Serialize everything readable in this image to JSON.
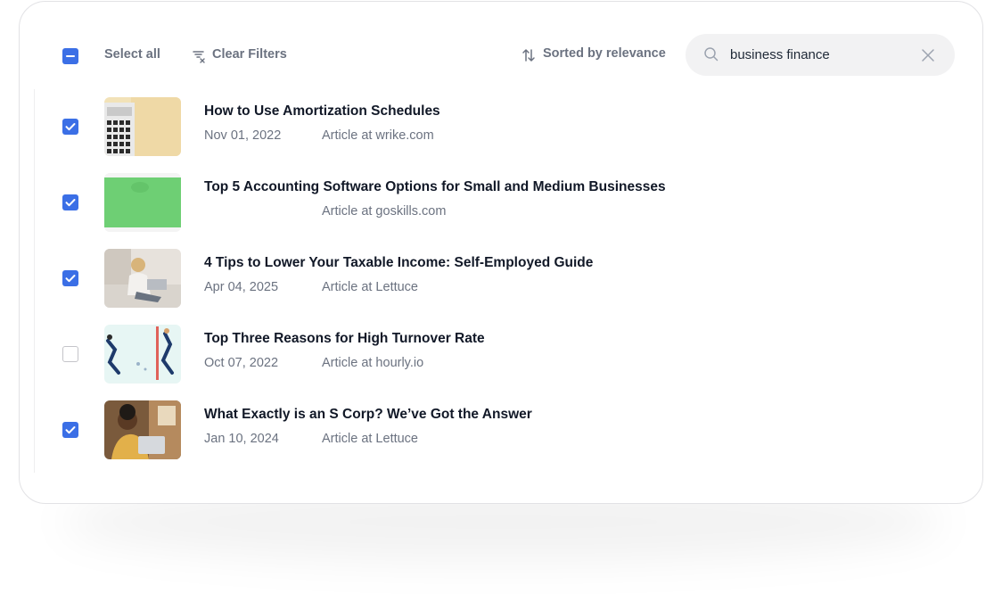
{
  "toolbar": {
    "select_all_label": "Select all",
    "select_all_state": "indeterminate",
    "clear_filters_label": "Clear Filters",
    "sort_label": "Sorted by relevance"
  },
  "search": {
    "value": "business finance",
    "placeholder": ""
  },
  "colors": {
    "accent": "#3b6fe6",
    "muted_text": "#6b7280",
    "search_bg": "#f2f2f3"
  },
  "results": [
    {
      "title": "How to Use Amortization Schedules",
      "date": "Nov 01, 2022",
      "source": "Article at wrike.com",
      "checked": true,
      "thumb": "calculator-thumbnail"
    },
    {
      "title": "Top 5 Accounting Software Options for Small and Medium Businesses",
      "date": "",
      "source": "Article at goskills.com",
      "checked": true,
      "thumb": "green-thumbnail"
    },
    {
      "title": "4 Tips to Lower Your Taxable Income: Self-Employed Guide",
      "date": "Apr 04, 2025",
      "source": "Article at Lettuce",
      "checked": true,
      "thumb": "woman-laptop-thumbnail"
    },
    {
      "title": "Top Three Reasons for High Turnover Rate",
      "date": "Oct 07, 2022",
      "source": "Article at hourly.io",
      "checked": false,
      "thumb": "illustration-thumbnail"
    },
    {
      "title": "What Exactly is an S Corp? We’ve Got the Answer",
      "date": "Jan 10, 2024",
      "source": "Article at Lettuce",
      "checked": true,
      "thumb": "man-laptop-thumbnail"
    }
  ]
}
